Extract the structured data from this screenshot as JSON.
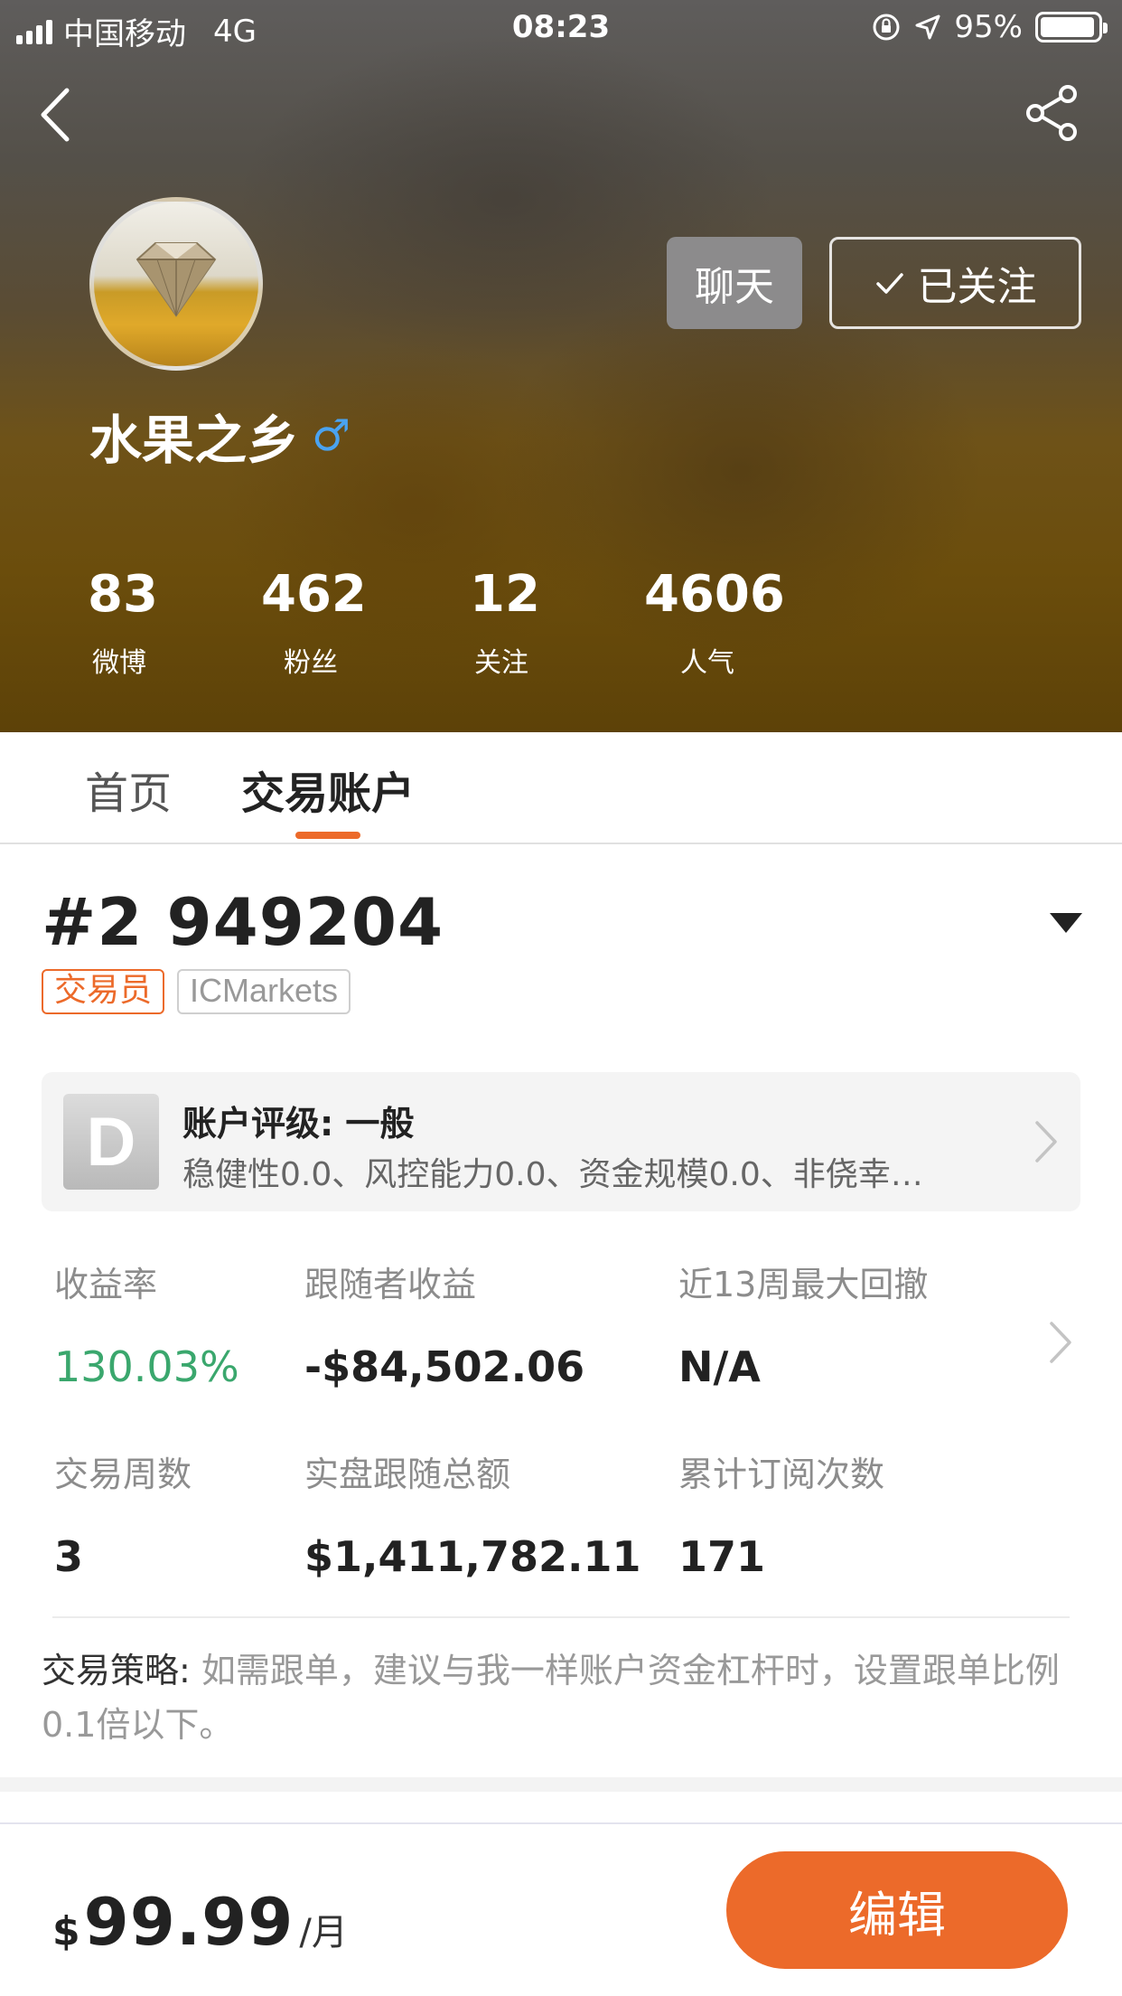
{
  "status_bar": {
    "carrier": "中国移动",
    "network": "4G",
    "time": "08:23",
    "battery": "95%",
    "battery_level": 0.95
  },
  "icons": {
    "back": "back-arrow-icon",
    "share": "share-icon",
    "check": "check-icon",
    "gender": "male-icon",
    "dropdown": "caret-down-icon",
    "chevron": "chevron-right-icon"
  },
  "profile": {
    "name": "水果之乡",
    "gender_symbol": "♂",
    "chat_label": "聊天",
    "follow_label": "已关注",
    "stats": [
      {
        "value": "83",
        "label": "微博"
      },
      {
        "value": "462",
        "label": "粉丝"
      },
      {
        "value": "12",
        "label": "关注"
      },
      {
        "value": "4606",
        "label": "人气"
      }
    ]
  },
  "tabs": [
    {
      "label": "首页",
      "active": false
    },
    {
      "label": "交易账户",
      "active": true
    }
  ],
  "account": {
    "title": "#2 949204",
    "tag_role": "交易员",
    "tag_broker": "ICMarkets",
    "rating": {
      "grade": "D",
      "title": "账户评级: 一般",
      "desc": "稳健性0.0、风控能力0.0、资金规模0.0、非侥幸…"
    },
    "metrics": [
      {
        "label": "收益率",
        "value": "130.03%"
      },
      {
        "label": "跟随者收益",
        "value": "-$84,502.06"
      },
      {
        "label": "近13周最大回撤",
        "value": "N/A"
      },
      {
        "label": "交易周数",
        "value": "3"
      },
      {
        "label": "实盘跟随总额",
        "value": "$1,411,782.11"
      },
      {
        "label": "累计订阅次数",
        "value": "171"
      }
    ],
    "strategy_label": "交易策略:",
    "strategy_text": " 如需跟单，建议与我一样账户资金杠杆时，设置跟单比例0.1倍以下。"
  },
  "bottom": {
    "currency": "$",
    "price": "99.99",
    "period": "/月",
    "edit_label": "编辑"
  },
  "colors": {
    "accent": "#ec6a2a",
    "positive": "#3aa76d",
    "chat_button": "#8c8b8c"
  }
}
